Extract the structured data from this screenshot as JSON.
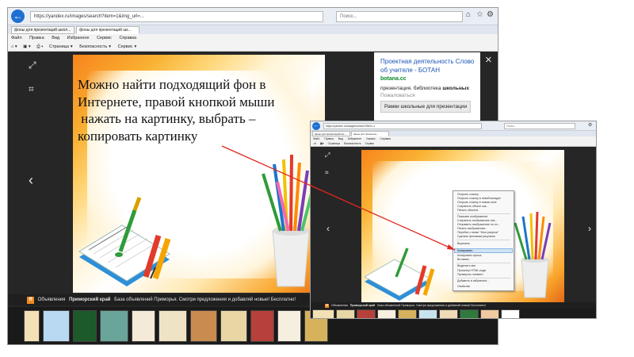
{
  "caption": {
    "lines": [
      "Можно найти подходящий фон в",
      "Интернете, правой кнопкой мыши",
      " нажать на картинку, выбрать –",
      "копировать картинку"
    ]
  },
  "browser_main": {
    "address": "https://yandex.ru/images/search?item=1&img_url=...",
    "search_placeholder": "Поиск...",
    "tabs": [
      "фоны для презентаций школ...",
      "фоны для презентаций шк..."
    ],
    "menu": [
      "Файл",
      "Правка",
      "Вид",
      "Избранное",
      "Сервис",
      "Справка"
    ],
    "commands": [
      "Страница",
      "Безопасность",
      "Сервис"
    ],
    "ad_strip": {
      "mark": "Я",
      "label": "Объявления",
      "site": "Приморский край",
      "text": "База объявлений Приморья. Смотри предложения и добавляй новые! Бесплатно!"
    }
  },
  "side_ad": {
    "title": "Проектная деятельность Слово об учителе - БОТАН",
    "domain": "botana.cc",
    "text_pre": "презентация. библиотека ",
    "text_bold": "школьных",
    "text_post": " Пожаловаться",
    "button": "Рамки школьные для презентации"
  },
  "browser_inset": {
    "address": "https://yandex.ru/images/search?item=1",
    "search_placeholder": "Поиск...",
    "tabs": [
      "фоны для презентаций шк...",
      "фоны для презентац..."
    ],
    "menu": [
      "Файл",
      "Правка",
      "Вид",
      "Избранное",
      "Сервис",
      "Справка"
    ],
    "commands": [
      "Страница",
      "Безопасность",
      "Сервис"
    ],
    "ad_strip": {
      "mark": "Я",
      "label": "Объявления",
      "site": "Приморский край",
      "text": "База объявлений Приморья. Смотри предложения и добавляй новые! Бесплатно!"
    }
  },
  "context_menu": {
    "items": [
      "Открыть ссылку",
      "Открыть ссылку в новой вкладке",
      "Открыть ссылку в новом окне",
      "Сохранить объект как...",
      "Печать объекта",
      "Показать изображение",
      "Сохранить изображение как...",
      "Отправить изображение по эл...",
      "Печать изображения...",
      "Перейти к папке \"Мои рисунки\"",
      "Сделать фоновым рисунком",
      "Вырезать",
      "Копировать",
      "Копировать ярлык",
      "Вставить",
      "Выделить все",
      "Просмотр HTML-кода",
      "Проверить элемент",
      "Добавить в избранное...",
      "Свойства"
    ],
    "highlighted_index": 12
  },
  "icons": {
    "close": "×",
    "crop": "crop-icon",
    "prev": "‹",
    "next": "›",
    "expand": "⤢"
  },
  "colors": {
    "accent": "#1e6fd0",
    "viewer_bg": "#262626",
    "arrow": "#e0261f",
    "frame_orange": "#f7841c"
  }
}
